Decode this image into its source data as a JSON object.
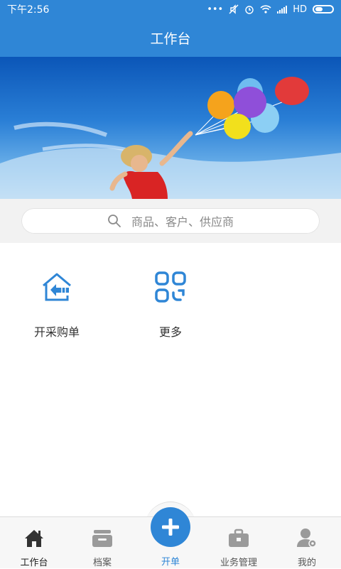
{
  "status_bar": {
    "time": "下午2:56",
    "network_label": "HD"
  },
  "header": {
    "title": "工作台"
  },
  "search": {
    "placeholder": "商品、客户、供应商"
  },
  "shortcuts": [
    {
      "label": "开采购单",
      "icon": "house-arrow-icon"
    },
    {
      "label": "更多",
      "icon": "grid-more-icon"
    }
  ],
  "tabbar": {
    "tabs": [
      {
        "label": "工作台",
        "icon": "home-icon",
        "active": true
      },
      {
        "label": "档案",
        "icon": "archive-box-icon",
        "active": false
      },
      {
        "label": "开单",
        "icon": "plus-icon",
        "active": false
      },
      {
        "label": "业务管理",
        "icon": "briefcase-icon",
        "active": false
      },
      {
        "label": "我的",
        "icon": "user-gear-icon",
        "active": false
      }
    ]
  },
  "colors": {
    "primary": "#2f86d6",
    "tab_inactive": "#9a9a9a",
    "text": "#333333"
  }
}
